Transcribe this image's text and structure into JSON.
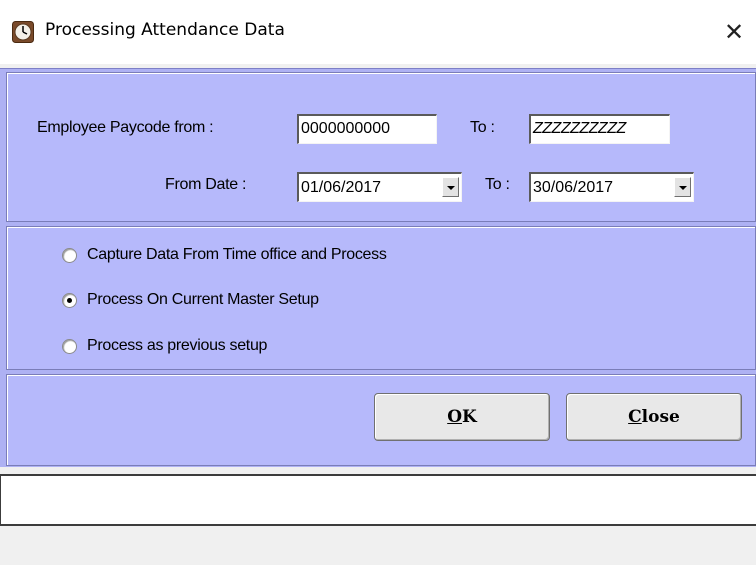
{
  "window": {
    "title": "Processing Attendance Data",
    "close_glyph": "✕",
    "icon": "clock-icon"
  },
  "paycode": {
    "label": "Employee Paycode from :",
    "from_value": "0000000000",
    "to_label": "To :",
    "to_value": "ZZZZZZZZZZ"
  },
  "dates": {
    "from_label": "From Date :",
    "from_value": "01/06/2017",
    "to_label": "To :",
    "to_value": "30/06/2017"
  },
  "options": [
    {
      "label": "Capture Data From Time office and Process",
      "selected": false
    },
    {
      "label": "Process On Current Master Setup",
      "selected": true
    },
    {
      "label": "Process as previous setup",
      "selected": false
    }
  ],
  "buttons": {
    "ok_accel": "O",
    "ok_rest": "K",
    "close_accel": "C",
    "close_rest": "lose"
  },
  "colors": {
    "panel": "#b6b9fb",
    "pane": "#aeb1f3"
  }
}
